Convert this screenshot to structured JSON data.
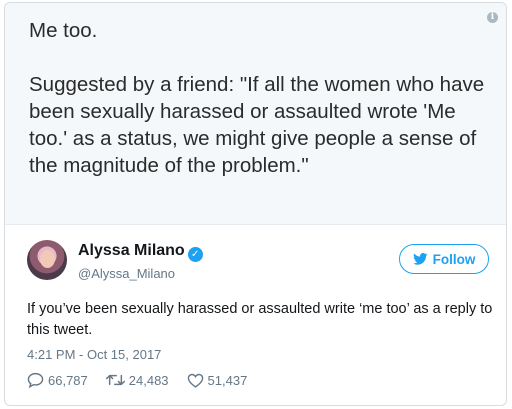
{
  "image_text": "Me too.\n\nSuggested by a friend: \"If all the women who have been sexually harassed or assaulted wrote 'Me too.' as a status, we might give people a sense of the magnitude of the problem.\"",
  "author": {
    "name": "Alyssa Milano",
    "handle": "@Alyssa_Milano",
    "verified": true
  },
  "follow_label": "Follow",
  "tweet_text": "If you’ve been sexually harassed or assaulted write ‘me too’ as a reply to this tweet.",
  "timestamp": "4:21 PM - Oct 15, 2017",
  "stats": {
    "replies": "66,787",
    "retweets": "24,483",
    "likes": "51,437"
  },
  "colors": {
    "accent": "#1da1f2",
    "muted": "#657786",
    "image_bg": "#f5f8fa"
  },
  "icons": [
    "info-icon",
    "verified-badge-icon",
    "twitter-bird-icon",
    "reply-icon",
    "retweet-icon",
    "like-icon"
  ]
}
